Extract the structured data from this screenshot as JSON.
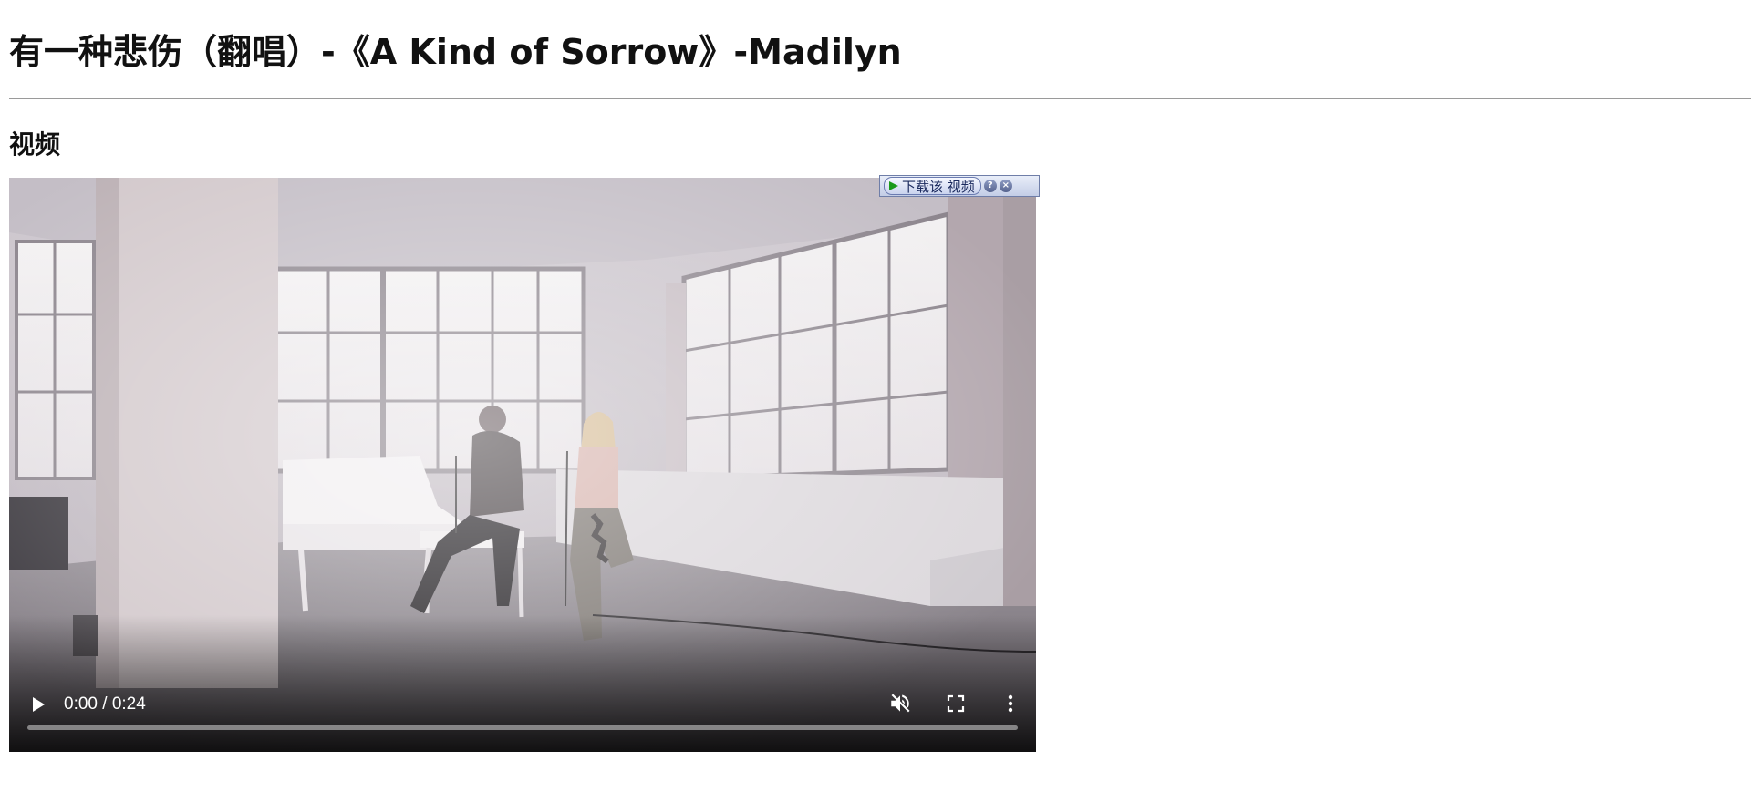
{
  "page": {
    "title": "有一种悲伤（翻唱）-《A Kind of Sorrow》-Madilyn",
    "section_heading": "视频"
  },
  "video": {
    "time_display": "0:00 / 0:24",
    "current_time": "0:00",
    "duration": "0:24",
    "progress": 0,
    "muted": true,
    "controls": [
      "play-icon",
      "muted-volume-icon",
      "fullscreen-icon",
      "more-vert-icon"
    ]
  },
  "download_toolbar": {
    "download_label": "下载该 视频",
    "help_icon": "question-icon",
    "close_icon": "close-icon",
    "accent": "#1a9a1a"
  },
  "colors": {
    "divider": "#9a9a9a",
    "toolbar_border": "#6f7ea8"
  }
}
